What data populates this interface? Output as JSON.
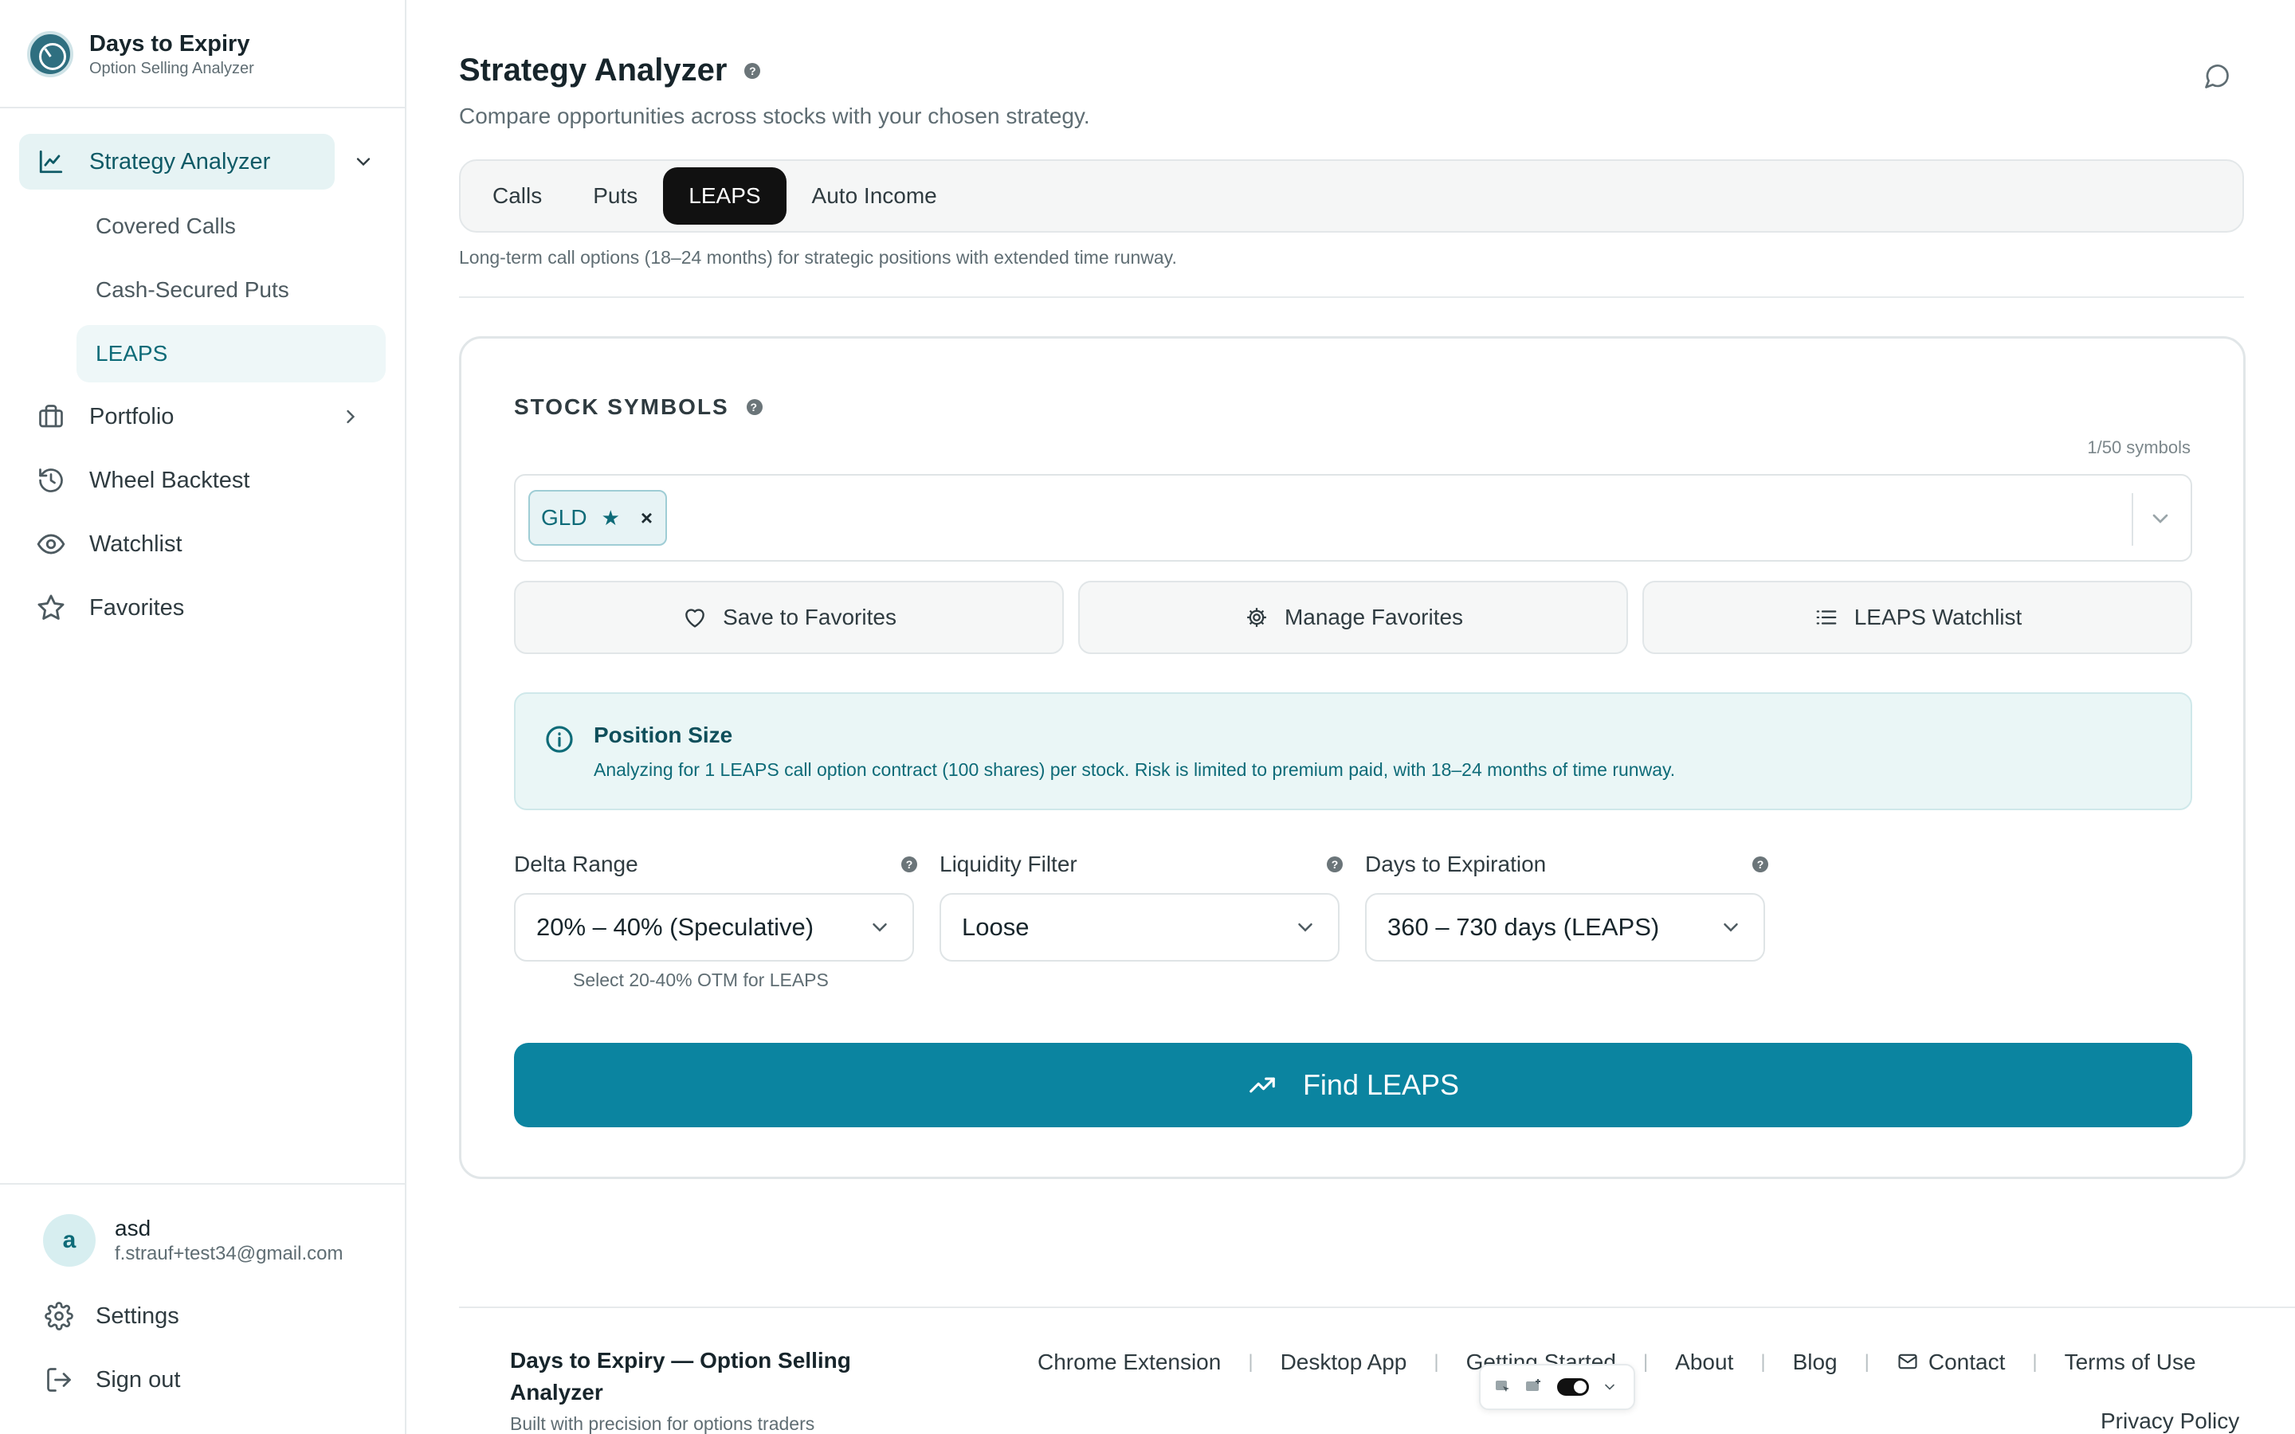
{
  "brand": {
    "title": "Days to Expiry",
    "subtitle": "Option Selling Analyzer"
  },
  "sidebar": {
    "items": [
      {
        "label": "Strategy Analyzer",
        "icon": "line-chart-icon",
        "active": true,
        "expanded": true
      },
      {
        "label": "Portfolio",
        "icon": "briefcase-icon"
      },
      {
        "label": "Wheel Backtest",
        "icon": "history-icon"
      },
      {
        "label": "Watchlist",
        "icon": "eye-icon"
      },
      {
        "label": "Favorites",
        "icon": "star-icon"
      }
    ],
    "sub_items": [
      {
        "label": "Covered Calls"
      },
      {
        "label": "Cash-Secured Puts"
      },
      {
        "label": "LEAPS",
        "active": true
      }
    ]
  },
  "user": {
    "initial": "a",
    "name": "asd",
    "email": "f.strauf+test34@gmail.com"
  },
  "bottom_nav": {
    "settings": "Settings",
    "sign_out": "Sign out"
  },
  "header": {
    "title": "Strategy Analyzer",
    "help": "?",
    "subtitle": "Compare opportunities across stocks with your chosen strategy."
  },
  "tabs": [
    {
      "label": "Calls"
    },
    {
      "label": "Puts"
    },
    {
      "label": "LEAPS",
      "active": true
    },
    {
      "label": "Auto Income"
    }
  ],
  "tab_description": "Long-term call options (18–24 months) for strategic positions with extended time runway.",
  "symbols": {
    "label": "STOCK SYMBOLS",
    "count": "1/50 symbols",
    "chips": [
      {
        "symbol": "GLD"
      }
    ]
  },
  "favorites_buttons": {
    "save": "Save to Favorites",
    "manage": "Manage Favorites",
    "watchlist": "LEAPS Watchlist"
  },
  "position_size": {
    "title": "Position Size",
    "text": "Analyzing for 1 LEAPS call option contract (100 shares) per stock. Risk is limited to premium paid, with 18–24 months of time runway."
  },
  "filters": {
    "delta": {
      "label": "Delta Range",
      "value": "20% – 40% (Speculative)",
      "hint": "Select 20-40% OTM for LEAPS"
    },
    "liquidity": {
      "label": "Liquidity Filter",
      "value": "Loose"
    },
    "expiration": {
      "label": "Days to Expiration",
      "value": "360 – 730 days (LEAPS)"
    }
  },
  "find_button": "Find LEAPS",
  "footer": {
    "brand": "Days to Expiry — Option Selling Analyzer",
    "tagline": "Built with precision for options traders",
    "links": {
      "chrome": "Chrome Extension",
      "desktop": "Desktop App",
      "getting_started": "Getting Started",
      "about": "About",
      "blog": "Blog",
      "contact": "Contact",
      "terms": "Terms of Use",
      "privacy": "Privacy Policy"
    },
    "separator": "|"
  },
  "colors": {
    "accent": "#0b84a0",
    "accent_dark": "#0e6b78",
    "active_tab": "#111111",
    "info_bg": "#eaf6f6"
  }
}
